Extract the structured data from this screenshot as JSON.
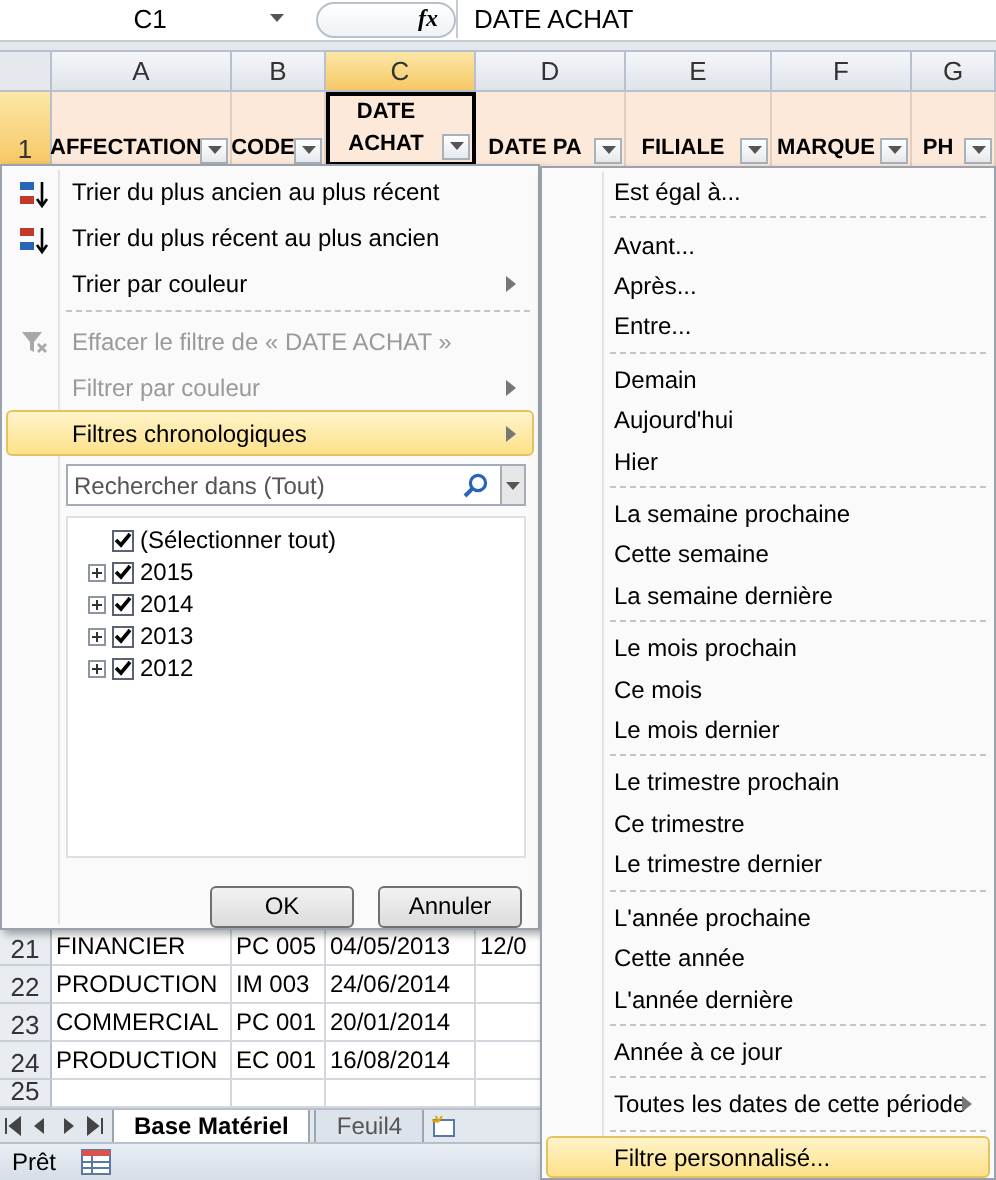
{
  "formula_bar": {
    "name_box": "C1",
    "function_label": "fx",
    "formula": "DATE ACHAT"
  },
  "columns": [
    {
      "label": "A",
      "selected": false
    },
    {
      "label": "B",
      "selected": false
    },
    {
      "label": "C",
      "selected": true
    },
    {
      "label": "D",
      "selected": false
    },
    {
      "label": "E",
      "selected": false
    },
    {
      "label": "F",
      "selected": false
    },
    {
      "label": "G",
      "selected": false
    }
  ],
  "header_row": {
    "number": "1",
    "selected": true,
    "cells": [
      {
        "text": "AFFECTATION",
        "filter": true,
        "selected": false
      },
      {
        "text": "CODE",
        "filter": true,
        "selected": false
      },
      {
        "text": "DATE ACHAT",
        "filter": true,
        "selected": true
      },
      {
        "text": "DATE PA",
        "filter": true,
        "selected": false
      },
      {
        "text": "FILIALE",
        "filter": true,
        "selected": false
      },
      {
        "text": "MARQUE",
        "filter": true,
        "selected": false
      },
      {
        "text": "PH",
        "filter": true,
        "selected": false
      }
    ]
  },
  "rows": [
    {
      "number": "21",
      "cells": [
        "FINANCIER",
        "PC 005",
        "04/05/2013",
        "12/0"
      ]
    },
    {
      "number": "22",
      "cells": [
        "PRODUCTION",
        "IM 003",
        "24/06/2014",
        ""
      ]
    },
    {
      "number": "23",
      "cells": [
        "COMMERCIAL",
        "PC 001",
        "20/01/2014",
        ""
      ]
    },
    {
      "number": "24",
      "cells": [
        "PRODUCTION",
        "EC 001",
        "16/08/2014",
        ""
      ]
    },
    {
      "number": "25",
      "cells": [
        "",
        "",
        "",
        ""
      ]
    }
  ],
  "sheet_tabs": [
    {
      "label": "Base Matériel",
      "selected": true
    },
    {
      "label": "Feuil4",
      "selected": false
    }
  ],
  "status_bar": {
    "text": "Prêt"
  },
  "filter_menu": {
    "items": [
      {
        "kind": "sort-asc",
        "label": "Trier du plus ancien au plus récent",
        "disabled": false,
        "highlighted": false,
        "submenu": false
      },
      {
        "kind": "sort-desc",
        "label": "Trier du plus récent au plus ancien",
        "disabled": false,
        "highlighted": false,
        "submenu": false
      },
      {
        "kind": "plain",
        "label": "Trier par couleur",
        "disabled": false,
        "highlighted": false,
        "submenu": true
      },
      {
        "kind": "separator"
      },
      {
        "kind": "clear",
        "label": "Effacer le filtre de « DATE ACHAT »",
        "disabled": true,
        "highlighted": false,
        "submenu": false
      },
      {
        "kind": "plain",
        "label": "Filtrer par couleur",
        "disabled": true,
        "highlighted": false,
        "submenu": true
      },
      {
        "kind": "plain",
        "label": "Filtres chronologiques",
        "disabled": false,
        "highlighted": true,
        "submenu": true
      }
    ],
    "search": {
      "placeholder": "Rechercher dans (Tout)"
    },
    "values": [
      {
        "label": "(Sélectionner tout)",
        "checked": true,
        "children": [
          {
            "label": "2015",
            "checked": true,
            "expanded": false
          },
          {
            "label": "2014",
            "checked": true,
            "expanded": false
          },
          {
            "label": "2013",
            "checked": true,
            "expanded": false
          },
          {
            "label": "2012",
            "checked": true,
            "expanded": false
          }
        ]
      }
    ],
    "buttons": [
      "OK",
      "Annuler"
    ]
  },
  "date_filters_menu": {
    "groups": [
      [
        {
          "label": "Est égal à...",
          "highlighted": false,
          "submenu": false
        }
      ],
      [
        {
          "label": "Avant...",
          "highlighted": false,
          "submenu": false
        },
        {
          "label": "Après...",
          "highlighted": false,
          "submenu": false
        },
        {
          "label": "Entre...",
          "highlighted": false,
          "submenu": false
        }
      ],
      [
        {
          "label": "Demain",
          "highlighted": false,
          "submenu": false
        },
        {
          "label": "Aujourd'hui",
          "highlighted": false,
          "submenu": false
        },
        {
          "label": "Hier",
          "highlighted": false,
          "submenu": false
        }
      ],
      [
        {
          "label": "La semaine prochaine",
          "highlighted": false,
          "submenu": false
        },
        {
          "label": "Cette semaine",
          "highlighted": false,
          "submenu": false
        },
        {
          "label": "La semaine dernière",
          "highlighted": false,
          "submenu": false
        }
      ],
      [
        {
          "label": "Le mois prochain",
          "highlighted": false,
          "submenu": false
        },
        {
          "label": "Ce mois",
          "highlighted": false,
          "submenu": false
        },
        {
          "label": "Le mois dernier",
          "highlighted": false,
          "submenu": false
        }
      ],
      [
        {
          "label": "Le trimestre prochain",
          "highlighted": false,
          "submenu": false
        },
        {
          "label": "Ce trimestre",
          "highlighted": false,
          "submenu": false
        },
        {
          "label": "Le trimestre dernier",
          "highlighted": false,
          "submenu": false
        }
      ],
      [
        {
          "label": "L'année prochaine",
          "highlighted": false,
          "submenu": false
        },
        {
          "label": "Cette année",
          "highlighted": false,
          "submenu": false
        },
        {
          "label": "L'année dernière",
          "highlighted": false,
          "submenu": false
        }
      ],
      [
        {
          "label": "Année à ce jour",
          "highlighted": false,
          "submenu": false
        }
      ],
      [
        {
          "label": "Toutes les dates de cette période",
          "highlighted": false,
          "submenu": true
        }
      ],
      [
        {
          "label": "Filtre personnalisé...",
          "highlighted": true,
          "submenu": false
        }
      ]
    ]
  }
}
